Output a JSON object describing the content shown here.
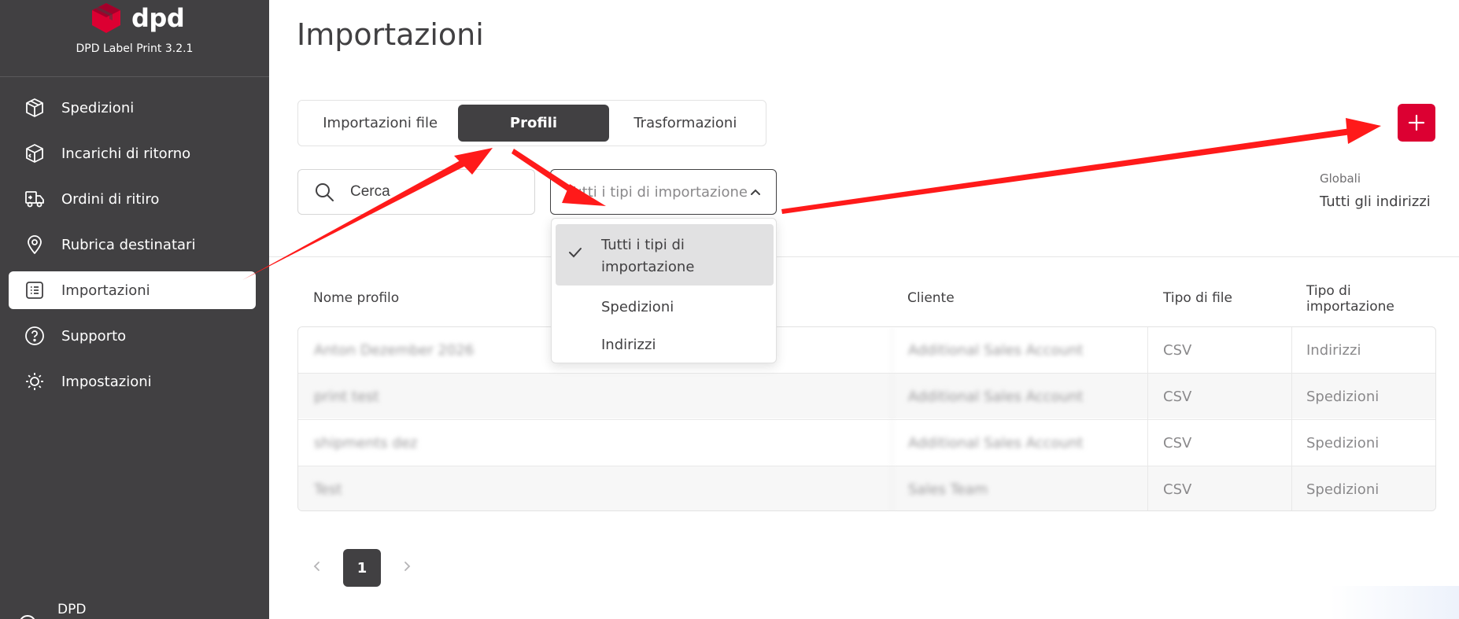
{
  "app": {
    "brand_name": "dpd",
    "version": "DPD Label Print 3.2.1",
    "accent_color": "#dc0032",
    "sidebar_color": "#414042"
  },
  "sidebar": {
    "items": [
      {
        "label": "Spedizioni",
        "icon": "box-icon"
      },
      {
        "label": "Incarichi di ritorno",
        "icon": "box-return-icon"
      },
      {
        "label": "Ordini di ritiro",
        "icon": "truck-icon"
      },
      {
        "label": "Rubrica destinatari",
        "icon": "location-pin-icon"
      },
      {
        "label": "Importazioni",
        "icon": "list-icon",
        "active": true
      },
      {
        "label": "Supporto",
        "icon": "help-icon"
      },
      {
        "label": "Impostazioni",
        "icon": "gear-icon"
      }
    ],
    "footer_label": "DPD"
  },
  "main": {
    "title": "Importazioni",
    "tabs": [
      {
        "label": "Importazioni file"
      },
      {
        "label": "Profili",
        "active": true
      },
      {
        "label": "Trasformazioni"
      }
    ],
    "search": {
      "placeholder": "Cerca"
    },
    "type_select": {
      "value": "Tutti i tipi di importazione"
    },
    "globals": {
      "label": "Globali",
      "value": "Tutti gli indirizzi"
    },
    "dropdown": {
      "options": [
        {
          "label": "Tutti i tipi di importazione",
          "selected": true
        },
        {
          "label": "Spedizioni"
        },
        {
          "label": "Indirizzi"
        }
      ]
    },
    "table": {
      "headers": [
        "Nome profilo",
        "Cliente",
        "Tipo di file",
        "Tipo di importazione"
      ],
      "rows": [
        {
          "name": "Anton Dezember 2026",
          "client": "Additional Sales Account",
          "file_type": "CSV",
          "import_type": "Indirizzi"
        },
        {
          "name": "print test",
          "client": "Additional Sales Account",
          "file_type": "CSV",
          "import_type": "Spedizioni"
        },
        {
          "name": "shipments dez",
          "client": "Additional Sales Account",
          "file_type": "CSV",
          "import_type": "Spedizioni"
        },
        {
          "name": "Test",
          "client": "Sales Team",
          "file_type": "CSV",
          "import_type": "Spedizioni"
        }
      ]
    },
    "pagination": {
      "current_page": "1"
    }
  }
}
